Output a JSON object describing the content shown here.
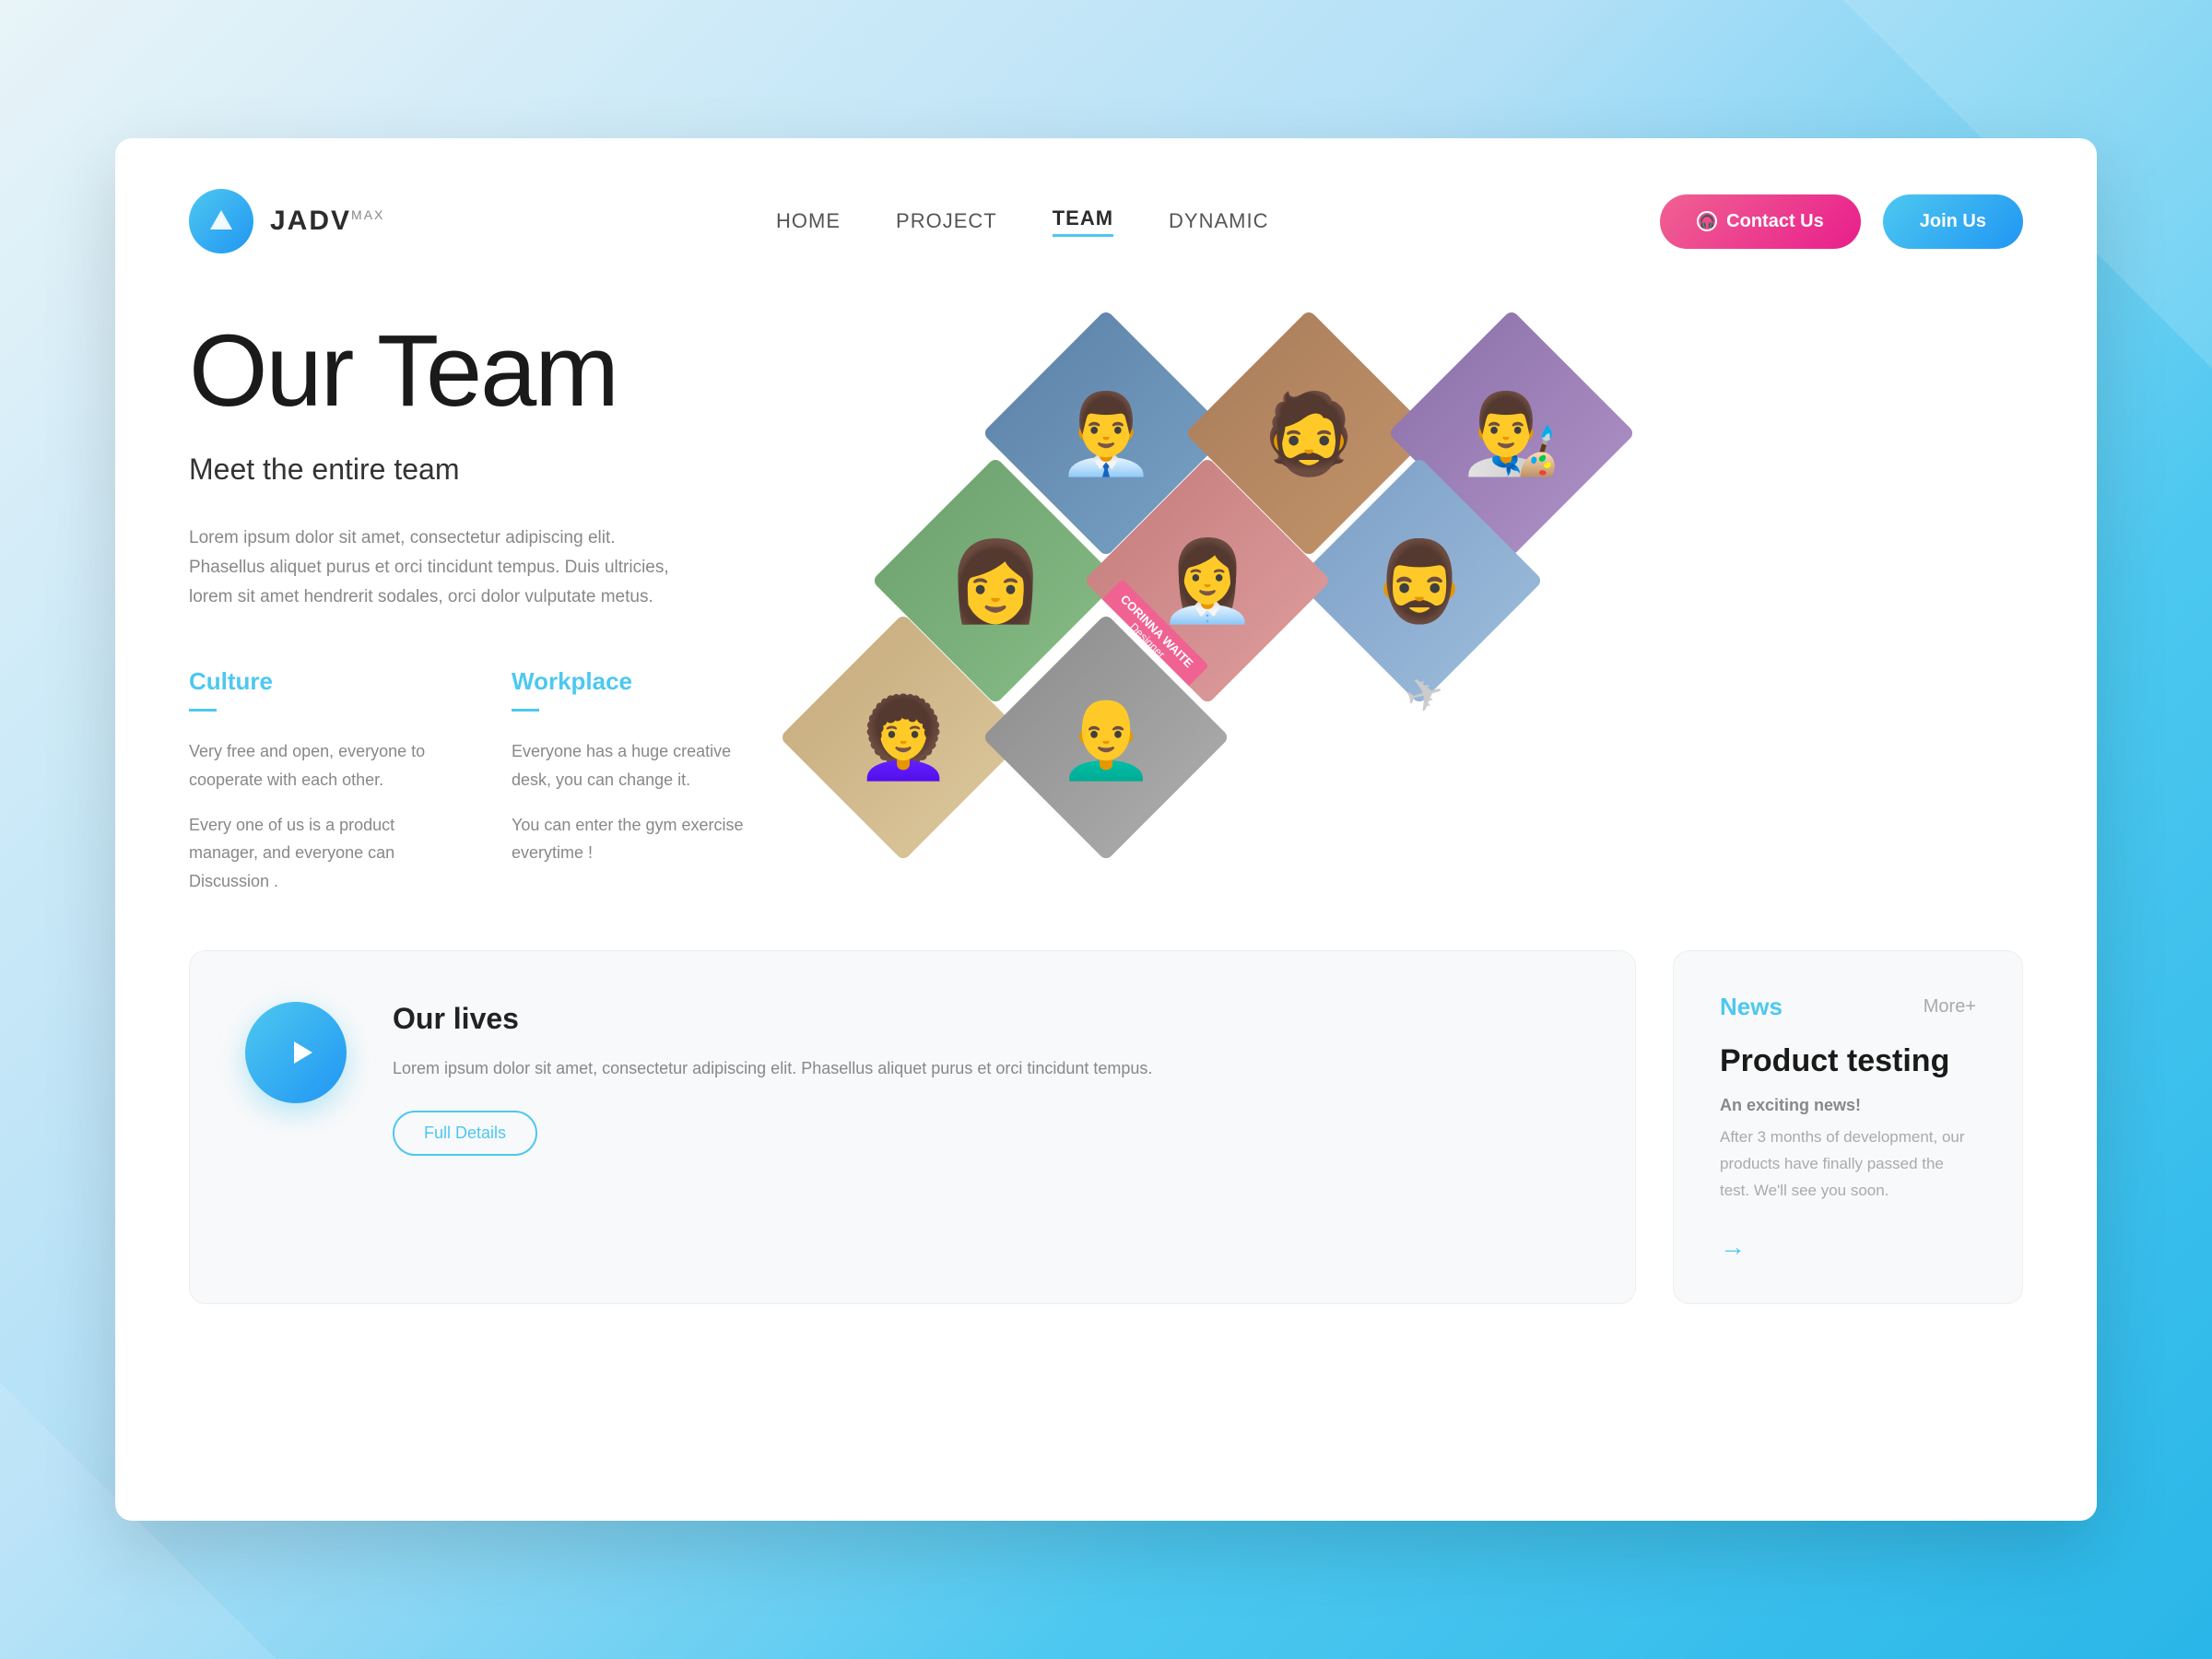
{
  "background": {
    "gradient_start": "#e8f4f8",
    "gradient_end": "#29b6e8"
  },
  "logo": {
    "text": "JADV",
    "superscript": "MAX"
  },
  "nav": {
    "links": [
      {
        "label": "HOME",
        "active": false
      },
      {
        "label": "PROJECT",
        "active": false
      },
      {
        "label": "TEAM",
        "active": true
      },
      {
        "label": "DYNAMIC",
        "active": false
      }
    ],
    "contact_button": "Contact Us",
    "join_button": "Join Us"
  },
  "hero": {
    "title": "Our Team",
    "subtitle": "Meet the entire team",
    "description": "Lorem ipsum dolor sit amet, consectetur adipiscing elit. Phasellus aliquet purus et orci tincidunt tempus. Duis ultricies, lorem sit amet hendrerit sodales, orci dolor vulputate metus."
  },
  "features": [
    {
      "title": "Culture",
      "paragraphs": [
        "Very free and open, everyone to cooperate with each other.",
        "Every one of us is a product manager, and everyone can Discussion ."
      ]
    },
    {
      "title": "Workplace",
      "paragraphs": [
        "Everyone has a huge creative desk, you can change it.",
        "You can enter the gym exercise everytime !"
      ]
    }
  ],
  "team_member": {
    "name": "CORINNA WAITE",
    "role": "Designer"
  },
  "lives_section": {
    "title": "Our lives",
    "description": "Lorem ipsum dolor sit amet, consectetur adipiscing elit. Phasellus aliquet purus et orci tincidunt tempus.",
    "button": "Full Details"
  },
  "news_section": {
    "label": "News",
    "more": "More+",
    "title": "Product testing",
    "subtitle": "An exciting news!",
    "body": "After 3 months of development, our products have finally passed the test. We'll see you soon."
  }
}
